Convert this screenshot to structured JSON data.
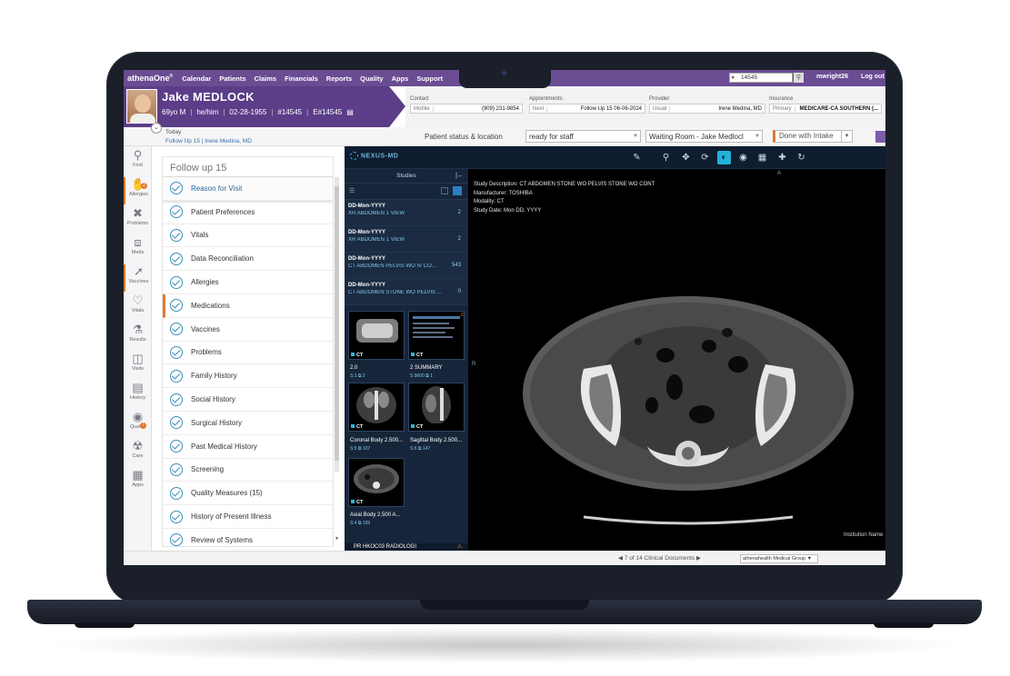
{
  "topnav": {
    "brand": "athenaOne",
    "brand_mark": "®",
    "items": [
      "Calendar",
      "Patients",
      "Claims",
      "Financials",
      "Reports",
      "Quality",
      "Apps",
      "Support"
    ],
    "search_value": "14545",
    "user": "mwright26",
    "logout": "Log out"
  },
  "patient": {
    "name": "Jake MEDLOCK",
    "age_sex": "69yo M",
    "pronouns": "he/him",
    "dob": "02-28-1955",
    "id": "#14545",
    "eid": "E#14545"
  },
  "contact": {
    "label": "Contact",
    "type": "Mobile",
    "value": "(909) 231-9854"
  },
  "appointments": {
    "label": "Appointments",
    "key": "Next",
    "value": "Follow Up 15 06-06-2024"
  },
  "provider": {
    "label": "Provider",
    "key": "Usual",
    "value": "Irene Medina, MD"
  },
  "insurance": {
    "label": "Insurance",
    "key": "Primary",
    "value": "MEDICARE-CA SOUTHERN (..."
  },
  "status": {
    "today": "Today",
    "follow_link": "Follow Up 15 | Irene Medina, MD",
    "label": "Patient status & location",
    "status_value": "ready for staff",
    "location_value": "Waiting Room - Jake Medlocl",
    "intake_button": "Done with Intake"
  },
  "rail": [
    {
      "label": "Find",
      "icon": "search-icon"
    },
    {
      "label": "Allergies",
      "icon": "hand-icon",
      "badge": "2"
    },
    {
      "label": "Problems",
      "icon": "bandage-icon"
    },
    {
      "label": "Meds",
      "icon": "pill-icon"
    },
    {
      "label": "Vaccines",
      "icon": "syringe-icon"
    },
    {
      "label": "Vitals",
      "icon": "heart-icon"
    },
    {
      "label": "Results",
      "icon": "flask-icon"
    },
    {
      "label": "Visits",
      "icon": "medical-bag-icon"
    },
    {
      "label": "History",
      "icon": "clipboard-icon"
    },
    {
      "label": "Quality",
      "icon": "award-icon",
      "badge": "!"
    },
    {
      "label": "Care",
      "icon": "care-icon"
    },
    {
      "label": "Apps",
      "icon": "grid-icon"
    }
  ],
  "checklist": {
    "title": "Follow up 15",
    "items": [
      "Reason for Visit",
      "Patient Preferences",
      "Vitals",
      "Data Reconciliation",
      "Allergies",
      "Medications",
      "Vaccines",
      "Problems",
      "Family History",
      "Social History",
      "Surgical History",
      "Past Medical History",
      "Screening",
      "Quality Measures  (15)",
      "History of Present Illness",
      "Review of Systems"
    ]
  },
  "viewer": {
    "logo": "NEXUS-MD",
    "studies_title": "Studies",
    "studies": [
      {
        "date": "DD-Mon-YYYY",
        "name": "XR ABDOMEN 1 VIEW",
        "count": "2"
      },
      {
        "date": "DD-Mon-YYYY",
        "name": "XR ABDOMEN 1 VIEW",
        "count": "2"
      },
      {
        "date": "DD-Mon-YYYY",
        "name": "CT ABDOMEN PELVIS WO IV CO...",
        "count": "543"
      },
      {
        "date": "DD-Mon-YYYY",
        "name": "CT ABDOMEN STONE WO PELVIS ...",
        "count": "0"
      }
    ],
    "series": [
      {
        "label": "2.0",
        "meta": "S:1  ⧉ 2",
        "tag": "CT"
      },
      {
        "label": "2 SUMMARY",
        "meta": "S:9000  ⧉ 1",
        "tag": "CT"
      },
      {
        "label": "Coronal Body 2.500...",
        "meta": "S:5  ⧉ 107",
        "tag": "CT"
      },
      {
        "label": "Sagittal Body 2.500...",
        "meta": "S:6  ⧉ 147",
        "tag": "CT"
      },
      {
        "label": "Axial Body 2.500 A...",
        "meta": "S:4  ⧉ 199",
        "tag": "CT"
      }
    ],
    "pr_row": "PR  HKOC03 RADIOLOGI",
    "meta": {
      "description": "Study Description:  CT ABDOMEN STONE WO PELVIS STONE WO CONT",
      "manufacturer": "Manufacturer:  TOSHIBA",
      "modality": "Modality:  CT",
      "date": "Study Date: Mon DD, YYYY"
    },
    "orient_top": "A",
    "orient_left": "R",
    "institution": "Institution Name"
  },
  "bottom": {
    "pager": "7 of 14 Clinical Documents",
    "group": "athenahealth Medical Group"
  },
  "colors": {
    "nav_purple": "#6a4c93",
    "banner_purple": "#5b3d88",
    "accent_orange": "#e07a2f",
    "check_blue": "#3b8fb8",
    "viewer_navy": "#17253a",
    "tool_active": "#22b1d8"
  }
}
